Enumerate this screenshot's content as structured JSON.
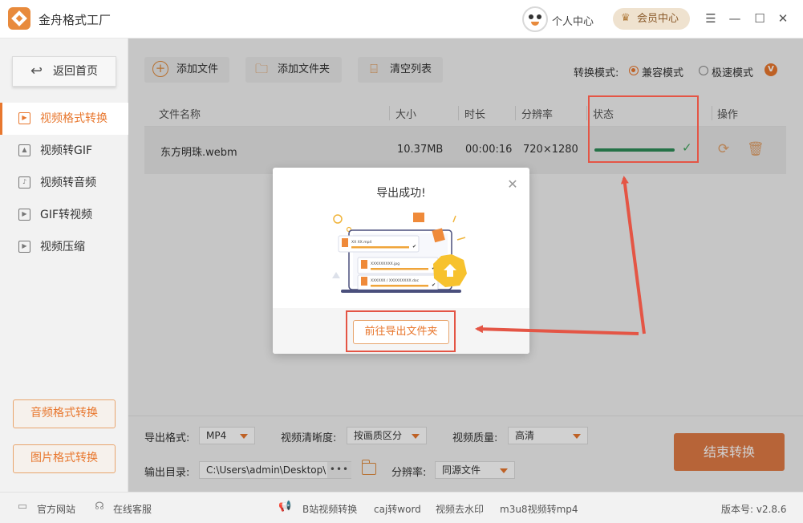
{
  "app": {
    "title": "金舟格式工厂",
    "personal_center": "个人中心",
    "vip_center": "会员中心"
  },
  "sidebar": {
    "home": "返回首页",
    "items": [
      {
        "label": "视频格式转换",
        "active": true
      },
      {
        "label": "视频转GIF",
        "active": false
      },
      {
        "label": "视频转音频",
        "active": false
      },
      {
        "label": "GIF转视频",
        "active": false
      },
      {
        "label": "视频压缩",
        "active": false
      }
    ],
    "audio_btn": "音频格式转换",
    "image_btn": "图片格式转换"
  },
  "toolbar": {
    "add_file": "添加文件",
    "add_folder": "添加文件夹",
    "clear_list": "清空列表",
    "mode_label": "转换模式:",
    "mode_compat": "兼容模式",
    "mode_fast": "极速模式",
    "badge": "V"
  },
  "table": {
    "headers": [
      "文件名称",
      "大小",
      "时长",
      "分辨率",
      "状态",
      "操作"
    ],
    "rows": [
      {
        "name": "东方明珠.webm",
        "size": "10.37MB",
        "duration": "00:00:16",
        "resolution": "720×1280",
        "progress": 1.0
      }
    ]
  },
  "settings": {
    "export_format_label": "导出格式:",
    "export_format": "MP4",
    "clarity_label": "视频清晰度:",
    "clarity": "按画质区分",
    "quality_label": "视频质量:",
    "quality": "高清",
    "output_dir_label": "输出目录:",
    "output_dir": "C:\\Users\\admin\\Desktop\\",
    "dots": "•••",
    "resolution_label": "分辨率:",
    "resolution": "同源文件",
    "end_btn": "结束转换"
  },
  "footer": {
    "website": "官方网站",
    "support": "在线客服",
    "links": [
      "B站视频转换",
      "caj转word",
      "视频去水印",
      "m3u8视频转mp4"
    ],
    "version": "版本号: v2.8.6"
  },
  "modal": {
    "title": "导出成功!",
    "button": "前往导出文件夹",
    "illustration": {
      "file1": "XX XX.mp4",
      "file2": "XXXXXXXXX.jpg",
      "file3": "XXXXXX / XXXXXXXXX.doc"
    }
  },
  "colors": {
    "accent": "#e8772e",
    "highlight": "#e45545",
    "progress": "#2e8b57"
  }
}
